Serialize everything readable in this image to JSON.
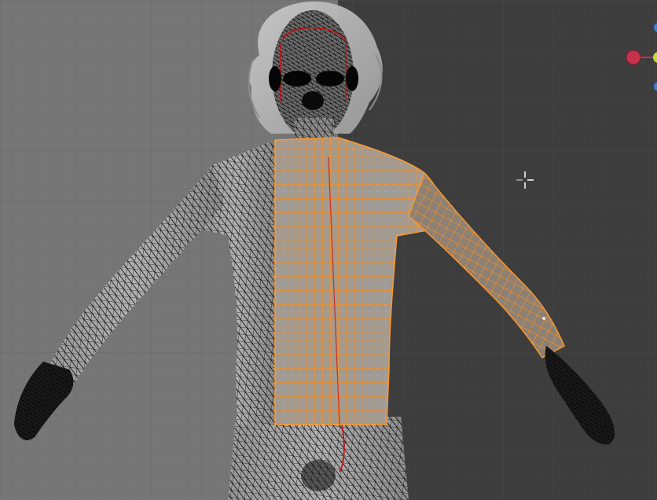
{
  "viewport": {
    "view": "front-orthographic",
    "mode": "edit-mode",
    "colors": {
      "bg_left": "#767676",
      "bg_right": "#3d3d3d",
      "grid_minor": "#6e6e6e",
      "grid_major": "#5a5a5a",
      "wire": "#0b0b0b",
      "selected": "#ff8c1a",
      "seam": "#d01010",
      "hair": "#b9b9b9"
    },
    "icons": {
      "cursor": "3d-cursor-icon",
      "gizmo": "navigation-gizmo-icon"
    }
  }
}
